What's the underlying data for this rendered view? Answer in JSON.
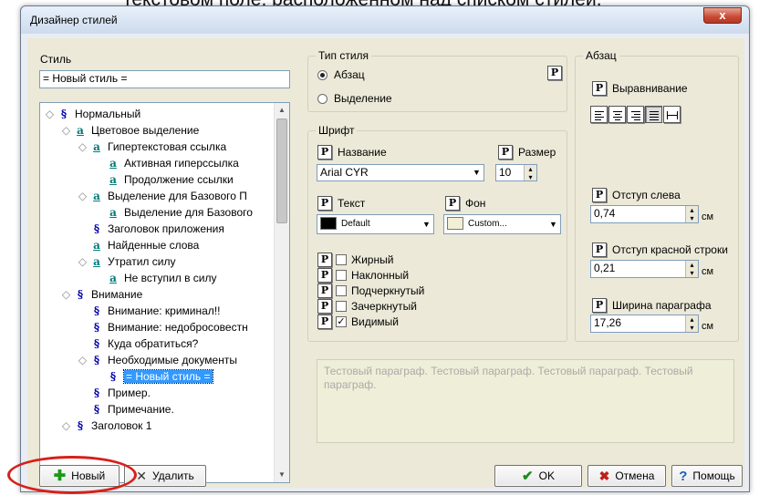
{
  "caption_text": "текстовом поле, расположенном над списком стилей.",
  "window": {
    "title": "Дизайнер стилей",
    "close_symbol": "x"
  },
  "style_panel": {
    "label": "Стиль",
    "name_value": "= Новый стиль ="
  },
  "tree": {
    "items": [
      {
        "label": "Нормальный",
        "icon": "paragraph-style-icon",
        "glyph": "§"
      },
      {
        "label": "Цветовое выделение",
        "icon": "character-style-icon",
        "glyph": "a"
      },
      {
        "label": "Гипертекстовая ссылка",
        "icon": "character-style-icon",
        "glyph": "a"
      },
      {
        "label": "Активная гиперссылка",
        "icon": "character-style-icon",
        "glyph": "a"
      },
      {
        "label": "Продолжение ссылки",
        "icon": "character-style-icon",
        "glyph": "a"
      },
      {
        "label": "Выделение для Базового П",
        "icon": "character-style-icon",
        "glyph": "a"
      },
      {
        "label": "Выделение для Базового",
        "icon": "character-style-icon",
        "glyph": "a"
      },
      {
        "label": "Заголовок приложения",
        "icon": "paragraph-style-icon",
        "glyph": "§"
      },
      {
        "label": "Найденные слова",
        "icon": "character-style-icon",
        "glyph": "a"
      },
      {
        "label": "Утратил силу",
        "icon": "character-style-icon",
        "glyph": "a"
      },
      {
        "label": "Не вступил в силу",
        "icon": "character-style-icon",
        "glyph": "a"
      },
      {
        "label": "Внимание",
        "icon": "paragraph-style-icon",
        "glyph": "§"
      },
      {
        "label": "Внимание: криминал!!",
        "icon": "paragraph-style-icon",
        "glyph": "§"
      },
      {
        "label": "Внимание: недобросовестн",
        "icon": "paragraph-style-icon",
        "glyph": "§"
      },
      {
        "label": "Куда обратиться?",
        "icon": "paragraph-style-icon",
        "glyph": "§"
      },
      {
        "label": "Необходимые документы",
        "icon": "paragraph-style-icon",
        "glyph": "§"
      },
      {
        "label": "= Новый стиль =",
        "icon": "paragraph-style-icon",
        "glyph": "§",
        "selected": true
      },
      {
        "label": "Пример.",
        "icon": "paragraph-style-icon",
        "glyph": "§"
      },
      {
        "label": "Примечание.",
        "icon": "paragraph-style-icon",
        "glyph": "§"
      },
      {
        "label": "Заголовок 1",
        "icon": "paragraph-style-icon",
        "glyph": "§"
      }
    ]
  },
  "style_type": {
    "group_title": "Тип стиля",
    "option_paragraph": "Абзац",
    "option_selection": "Выделение",
    "selected": "Абзац",
    "p_button": "P"
  },
  "font": {
    "group_title": "Шрифт",
    "name_label": "Название",
    "name_value": "Arial CYR",
    "size_label": "Размер",
    "size_value": "10",
    "text_label": "Текст",
    "text_color_value": "Default",
    "text_color_swatch": "#000000",
    "bg_label": "Фон",
    "bg_color_value": "Custom...",
    "bg_color_swatch": "#f2efd6",
    "p_button": "P",
    "checkboxes": [
      {
        "label": "Жирный",
        "checked": false
      },
      {
        "label": "Наклонный",
        "checked": false
      },
      {
        "label": "Подчеркнутый",
        "checked": false
      },
      {
        "label": "Зачеркнутый",
        "checked": false
      },
      {
        "label": "Видимый",
        "checked": true
      }
    ]
  },
  "paragraph": {
    "group_title": "Абзац",
    "align_label": "Выравнивание",
    "align_selected": "justify",
    "indent_left_label": "Отступ слева",
    "indent_left_value": "0,74",
    "first_line_label": "Отступ красной строки",
    "first_line_value": "0,21",
    "width_label": "Ширина параграфа",
    "width_value": "17,26",
    "unit": "см",
    "p_button": "P"
  },
  "preview": {
    "text": "Тестовый параграф. Тестовый параграф. Тестовый параграф. Тестовый параграф."
  },
  "buttons": {
    "new": "Новый",
    "delete": "Удалить",
    "ok": "OK",
    "cancel": "Отмена",
    "help": "Помощь"
  },
  "colors": {
    "accent_red": "#d6201a",
    "selection": "#3399ff",
    "dialog_bg": "#ece9d8"
  }
}
